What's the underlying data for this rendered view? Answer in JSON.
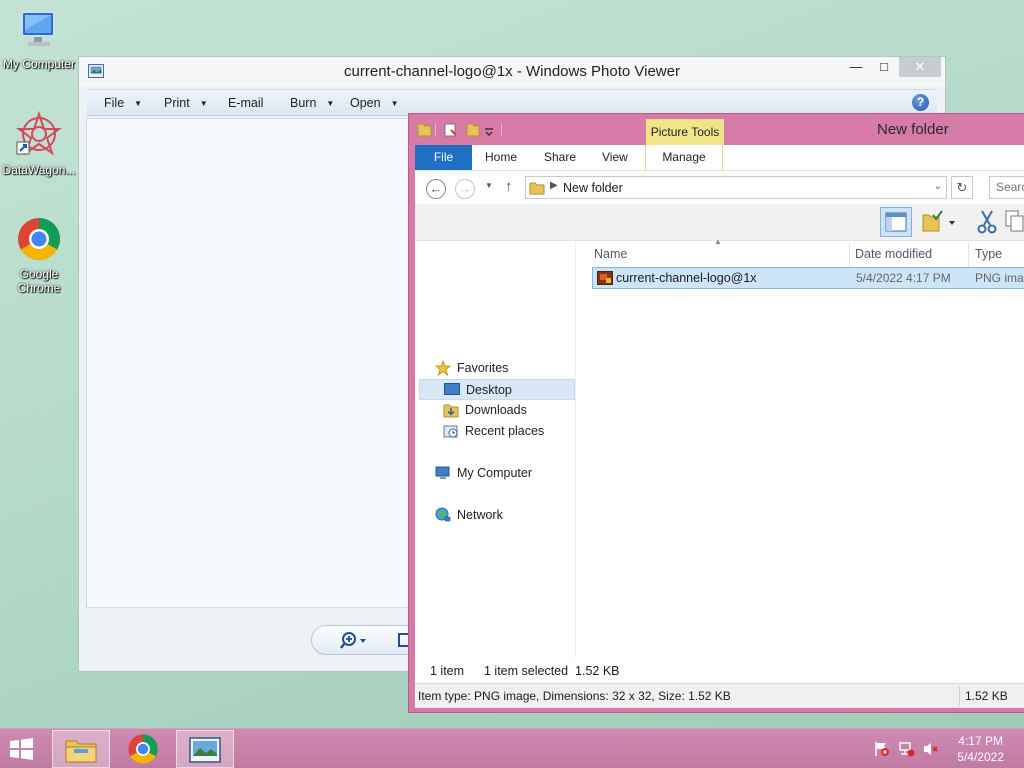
{
  "desktop": {
    "icons": [
      {
        "label": "My Computer",
        "icon": "my-computer-icon"
      },
      {
        "label": "DataWagon...",
        "icon": "datawagon-icon"
      },
      {
        "label": "Google Chrome",
        "icon": "chrome-icon"
      }
    ]
  },
  "photo_viewer": {
    "title": "current-channel-logo@1x - Windows Photo Viewer",
    "menus": [
      "File",
      "Print",
      "E-mail",
      "Burn",
      "Open"
    ],
    "help": "?",
    "controls": {
      "zoom_icon": "zoom-icon"
    }
  },
  "explorer": {
    "title": "New folder",
    "contextual_tab": "Picture Tools",
    "tabs": {
      "file": "File",
      "home": "Home",
      "share": "Share",
      "view": "View",
      "manage": "Manage"
    },
    "address": {
      "path": "New folder",
      "search_placeholder": "Searc"
    },
    "navigation": {
      "favorites": "Favorites",
      "desktop": "Desktop",
      "downloads": "Downloads",
      "recent": "Recent places",
      "computer": "My Computer",
      "network": "Network"
    },
    "columns": {
      "name": "Name",
      "date": "Date modified",
      "type": "Type"
    },
    "files": [
      {
        "name": "current-channel-logo@1x",
        "date": "5/4/2022 4:17 PM",
        "type": "PNG imag"
      }
    ],
    "status": {
      "count": "1 item",
      "selected": "1 item selected  1.52 KB"
    },
    "details": {
      "info": "Item type: PNG image, Dimensions: 32 x 32, Size: 1.52 KB",
      "size": "1.52 KB"
    }
  },
  "taskbar": {
    "time": "4:17 PM",
    "date": "5/4/2022"
  },
  "colors": {
    "explorer_frame": "#d67ba8",
    "taskbar": "#c582a8",
    "picture_tools": "#f1e58a",
    "file_tab": "#1f6fc5",
    "selection": "#cde6f7"
  }
}
